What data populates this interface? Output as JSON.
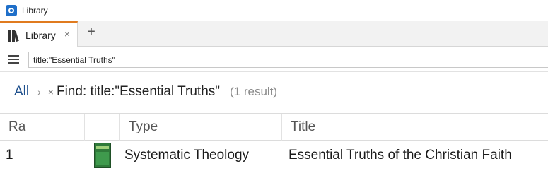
{
  "window": {
    "title": "Library",
    "icon": "logos-app-icon"
  },
  "tabs": [
    {
      "label": "Library",
      "icon": "books-icon",
      "close_label": "×"
    }
  ],
  "new_tab_label": "+",
  "search": {
    "value": "title:\"Essential Truths\""
  },
  "breadcrumb": {
    "all_label": "All",
    "separator": "›",
    "remove_label": "×",
    "find_label": "Find: title:\"Essential Truths\"",
    "result_count": "(1 result)"
  },
  "table": {
    "columns": [
      "Ra",
      "",
      "",
      "Type",
      "Title"
    ],
    "rows": [
      {
        "rank": "1",
        "cover_icon": "book-cover-thumbnail",
        "type": "Systematic Theology",
        "title": "Essential Truths of the Christian Faith"
      }
    ]
  },
  "colors": {
    "active_tab_accent": "#e07b1f",
    "link": "#1d4f8c",
    "muted": "#8a8a8a"
  }
}
